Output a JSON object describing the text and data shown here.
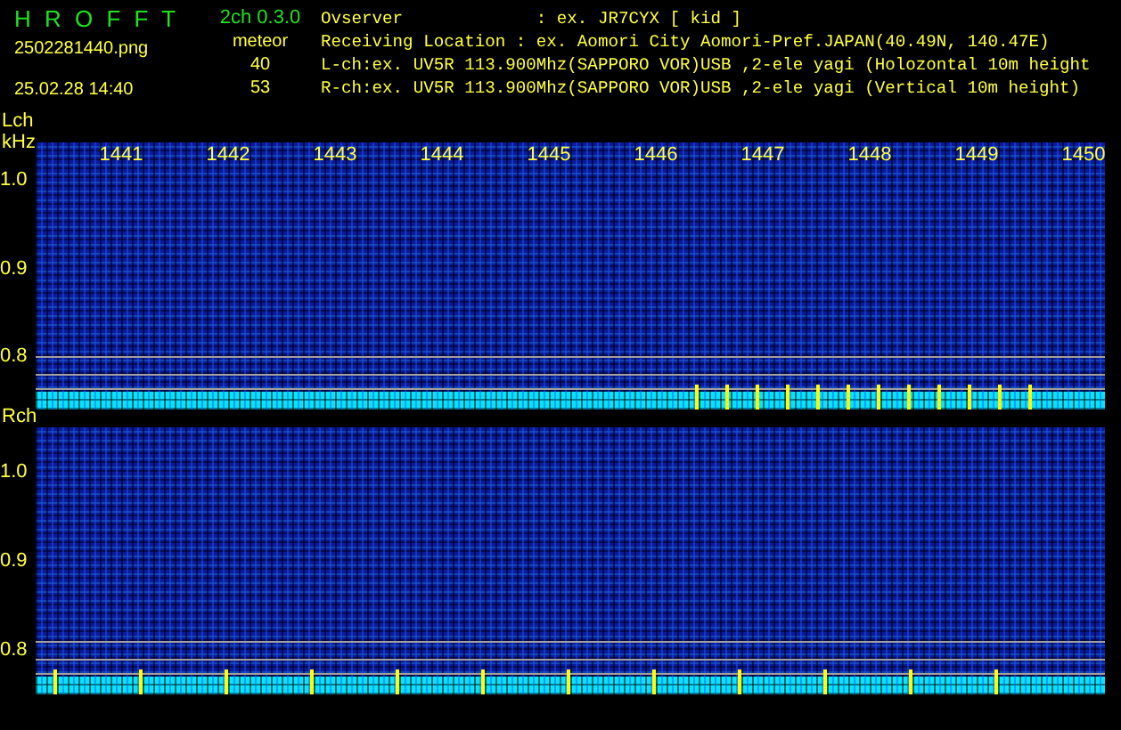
{
  "header": {
    "app_title": "H R O F F T",
    "version": "2ch 0.3.0",
    "filename": "2502281440.png",
    "timestamp": "25.02.28 14:40",
    "meteor_label": "meteor",
    "meteor_counts": [
      "40",
      "53"
    ],
    "info_lines": [
      "Ovserver             : ex. JR7CYX [ kid ]",
      "Receiving Location : ex. Aomori City Aomori-Pref.JAPAN(40.49N, 140.47E)",
      "L-ch:ex. UV5R 113.900Mhz(SAPPORO VOR)USB ,2-ele yagi (Holozontal 10m height",
      "R-ch:ex. UV5R 113.900Mhz(SAPPORO VOR)USB ,2-ele yagi (Vertical 10m height)"
    ]
  },
  "channels": [
    {
      "label": "Lch",
      "unit": "kHz",
      "time_labels": [
        "1441",
        "1442",
        "1443",
        "1444",
        "1445",
        "1446",
        "1447",
        "1448",
        "1449",
        "1450"
      ],
      "y_labels": [
        "1.0",
        "0.9",
        "0.8"
      ]
    },
    {
      "label": "Rch",
      "y_labels": [
        "1.0",
        "0.9",
        "0.8"
      ]
    }
  ]
}
